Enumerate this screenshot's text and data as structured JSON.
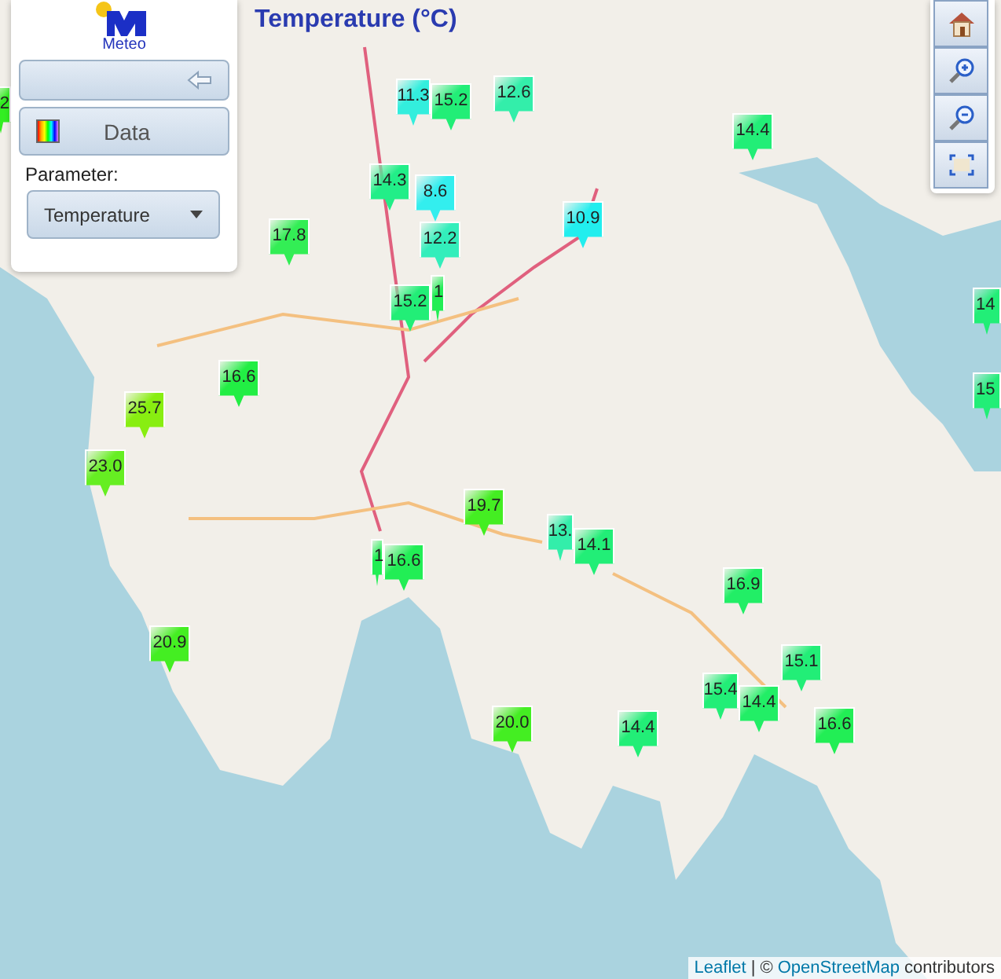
{
  "title": "Temperature (°C)",
  "panel": {
    "logo": "Meteo",
    "data_button": "Data",
    "parameter_label": "Parameter:",
    "parameter_select": "Temperature"
  },
  "markers": [
    {
      "text": "2",
      "color": "#33ee22"
    },
    {
      "text": "11.3",
      "color": "#33eedd"
    },
    {
      "text": "15.2",
      "color": "#22ee77"
    },
    {
      "text": "12.6",
      "color": "#33eeaa"
    },
    {
      "text": "14.4",
      "color": "#22ee77"
    },
    {
      "text": "14.3",
      "color": "#22ee88"
    },
    {
      "text": "8.6",
      "color": "#33eeee"
    },
    {
      "text": "12.2",
      "color": "#33eebb"
    },
    {
      "text": "10.9",
      "color": "#22eeee"
    },
    {
      "text": "17.8",
      "color": "#33ee55"
    },
    {
      "text": "1",
      "color": "#22ee55"
    },
    {
      "text": "15.2",
      "color": "#22ee77"
    },
    {
      "text": "16.6",
      "color": "#22ee44"
    },
    {
      "text": "25.7",
      "color": "#88ee11"
    },
    {
      "text": "23.0",
      "color": "#66ee22"
    },
    {
      "text": "19.7",
      "color": "#44ee22"
    },
    {
      "text": "13.",
      "color": "#33eeaa"
    },
    {
      "text": "14.1",
      "color": "#22ee77"
    },
    {
      "text": "1",
      "color": "#22ee55"
    },
    {
      "text": "16.6",
      "color": "#22ee55"
    },
    {
      "text": "16.9",
      "color": "#22ee66"
    },
    {
      "text": "20.9",
      "color": "#44ee22"
    },
    {
      "text": "15.1",
      "color": "#22ee77"
    },
    {
      "text": "15.4",
      "color": "#22ee77"
    },
    {
      "text": "14.4",
      "color": "#22ee66"
    },
    {
      "text": "20.0",
      "color": "#44ee22"
    },
    {
      "text": "14.4",
      "color": "#22ee77"
    },
    {
      "text": "16.6",
      "color": "#22ee55"
    },
    {
      "text": "14",
      "color": "#22ee77"
    },
    {
      "text": "15",
      "color": "#22ee77"
    }
  ],
  "attribution": {
    "link_1": "Leaflet",
    "separator": "| ©",
    "link_2": "OpenStreetMap",
    "suffix": "contributors"
  }
}
